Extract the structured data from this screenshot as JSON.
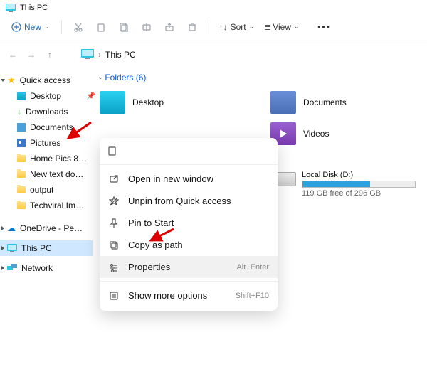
{
  "titlebar": {
    "title": "This PC"
  },
  "toolbar": {
    "new_label": "New",
    "sort_label": "Sort",
    "view_label": "View"
  },
  "breadcrumb": {
    "location": "This PC"
  },
  "sidebar": {
    "quick_access": "Quick access",
    "items": [
      {
        "label": "Desktop"
      },
      {
        "label": "Downloads"
      },
      {
        "label": "Documents"
      },
      {
        "label": "Pictures"
      },
      {
        "label": "Home Pics 8…"
      },
      {
        "label": "New text do…"
      },
      {
        "label": "output"
      },
      {
        "label": "Techviral Im…"
      }
    ],
    "onedrive": "OneDrive - Pe…",
    "thispc": "This PC",
    "network": "Network"
  },
  "content": {
    "folders_header": "Folders (6)",
    "folder_items": [
      {
        "label": "Desktop"
      },
      {
        "label": "Documents"
      },
      {
        "label": "Videos"
      }
    ],
    "disk": {
      "name": "Local Disk (D:)",
      "free_text": "119 GB free of 296 GB",
      "used_pct": 60
    }
  },
  "context_menu": {
    "items": [
      {
        "label": "Open in new window",
        "shortcut": ""
      },
      {
        "label": "Unpin from Quick access",
        "shortcut": ""
      },
      {
        "label": "Pin to Start",
        "shortcut": ""
      },
      {
        "label": "Copy as path",
        "shortcut": ""
      },
      {
        "label": "Properties",
        "shortcut": "Alt+Enter"
      },
      {
        "label": "Show more options",
        "shortcut": "Shift+F10"
      }
    ]
  }
}
